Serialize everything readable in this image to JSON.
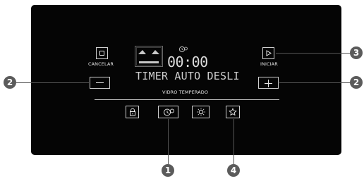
{
  "panel": {
    "cancel_label": "CANCELAR",
    "start_label": "INICIAR",
    "time_display": "00:00",
    "text_display": "TIMER AUTO DESLI",
    "glass_label": "VIDRO TEMPERADO"
  },
  "callouts": {
    "left": "2",
    "right_top": "3",
    "right": "2",
    "bottom_left": "1",
    "bottom_right": "4"
  },
  "icons": {
    "cancel": "stop-square-icon",
    "start": "play-icon",
    "minus": "minus-icon",
    "plus": "plus-icon",
    "lock": "lock-icon",
    "timer": "timer-icon",
    "light": "lamp-icon",
    "favorite": "star-icon",
    "oven": "oven-display-icon",
    "clock": "clock-indicator-icon"
  },
  "colors": {
    "panel": "#050505",
    "callout": "#5b5b5b",
    "display": "#dcdcdc"
  }
}
